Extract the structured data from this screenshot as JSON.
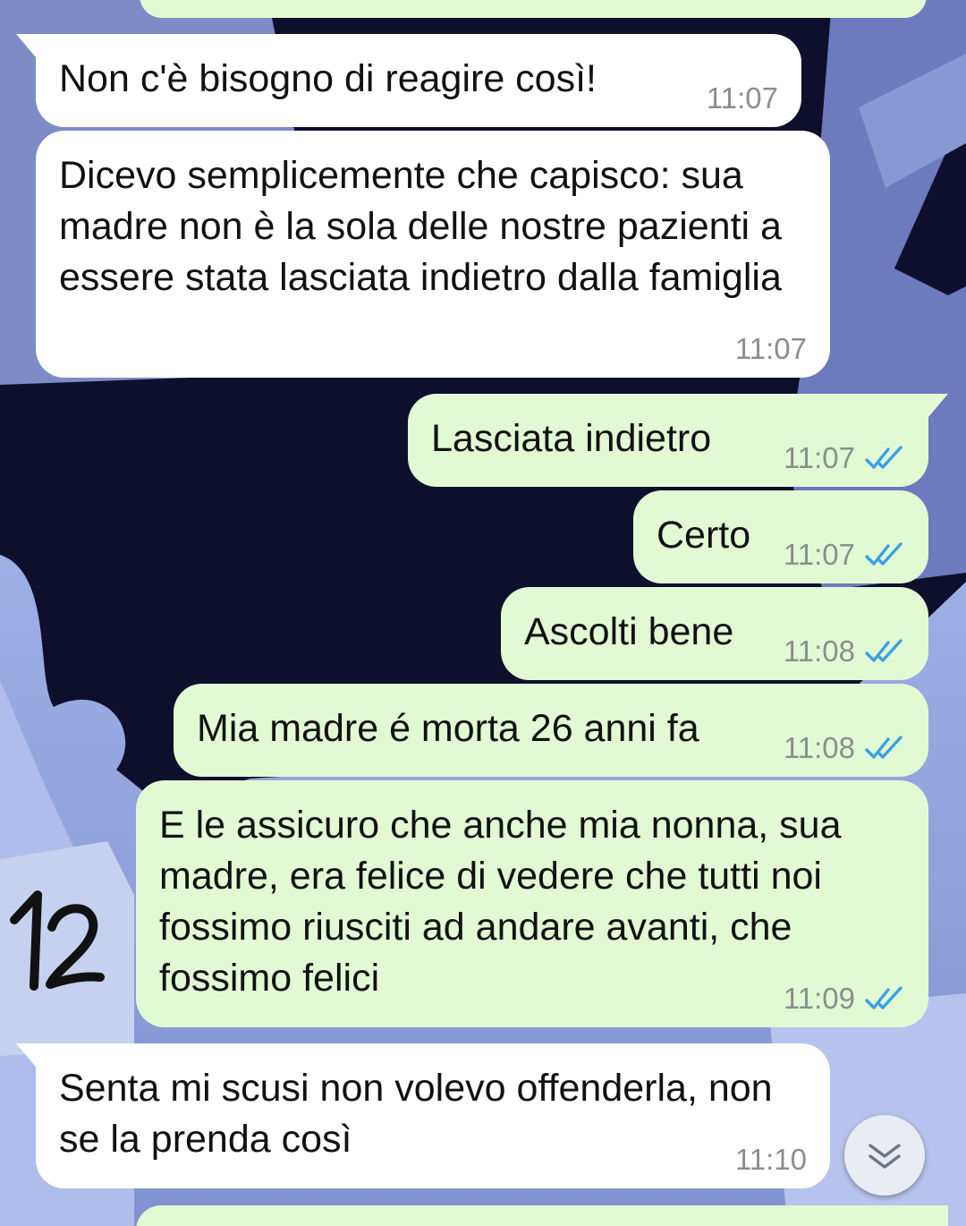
{
  "messages": [
    {
      "dir": "in",
      "text": "Non c'è bisogno di reagire così!",
      "time": "11:07"
    },
    {
      "dir": "in",
      "text": "Dicevo semplicemente che capisco: sua madre non è la sola delle nostre pazienti a essere stata lasciata indietro dalla famiglia",
      "time": "11:07"
    },
    {
      "dir": "out",
      "text": "Lasciata indietro",
      "time": "11:07",
      "status": "read"
    },
    {
      "dir": "out",
      "text": "Certo",
      "time": "11:07",
      "status": "read"
    },
    {
      "dir": "out",
      "text": "Ascolti bene",
      "time": "11:08",
      "status": "read"
    },
    {
      "dir": "out",
      "text": "Mia madre é morta 26 anni fa",
      "time": "11:08",
      "status": "read"
    },
    {
      "dir": "out",
      "text": "E le assicuro che anche mia nonna, sua madre, era felice di vedere che tutti noi fossimo riusciti ad andare avanti, che fossimo felici",
      "time": "11:09",
      "status": "read"
    },
    {
      "dir": "in",
      "text": "Senta mi scusi non volevo offenderla, non se la prenda così",
      "time": "11:10"
    }
  ],
  "annotation": "12",
  "icons": {
    "read_receipt": "double-check-icon",
    "scroll_down": "chevron-down-icon"
  },
  "colors": {
    "incoming_bubble": "#ffffff",
    "outgoing_bubble": "#e2fad3",
    "read_tick": "#3aa0e8",
    "time_text": "#8a8f8a",
    "wallpaper_dark": "#0d0f2c",
    "wallpaper_light": "#8e9ed6"
  }
}
